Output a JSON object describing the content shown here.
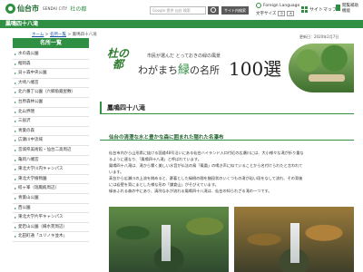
{
  "header": {
    "city_name": "仙台市",
    "city_sub": "SENDAI CITY",
    "city_tag": "杜の都",
    "search_placeholder": "Google 提供 仙台 検索",
    "site_search_label": "サイト内検索",
    "language_label": "Foreign Language",
    "text_size_label": "文字サイズ",
    "text_size_small": "小",
    "text_size_large": "大",
    "sitemap_label": "サイトマップ",
    "accessibility_label": "閲覧補助\n機能"
  },
  "titlebar": {
    "title": "鳳鳴四十八滝"
  },
  "breadcrumb": {
    "home": "ホーム",
    "sep1": " > ",
    "list": "名所一覧",
    "sep2": " > ",
    "current": "鳳鳴四十八滝"
  },
  "sidebar": {
    "title": "名所一覧",
    "items": [
      "水の森公園",
      "榴岡森",
      "貝ヶ森中央公園",
      "大崎八幡宮",
      "北六番丁公園（六郷角蔵屋敷）",
      "台原森林公園",
      "北山界隈",
      "三居沢",
      "青葉の森",
      "広瀬川中流域",
      "宮城県美術館・仙台二高周辺",
      "亀岡八幡宮",
      "東北大学川内キャンパス",
      "東北大学植物園",
      "経ヶ峯（瑞鳳殿周辺）",
      "青葉山公園",
      "西公園",
      "東北大学片平キャンパス",
      "愛宕山公園（縁水苑周辺）",
      "北田町通「ユリノキ並木」"
    ]
  },
  "main": {
    "updated": "更新日：2020年2月7日",
    "banner": {
      "mark": "杜の都",
      "subtitle": "市民が選んだ とっておきの緑の風景",
      "title_part1": "わがまち",
      "title_green": "緑",
      "title_part2": "の名所",
      "number": "100選"
    },
    "heading": "鳳鳴四十八滝",
    "subhead": "仙台の清澄な水と豊かな森に囲まれた隠れた名瀑布",
    "paragraphs": [
      "仙台市内から山形県に抜ける国道48号沿いにある仙台ハイランド入口付近の広瀬川には、大小様々な滝が折り重な",
      "るように連なり、「鳳鳴四十八滝」と呼ばれています。",
      "鳳鳴四十八滝は、滝から響く美しい水音が仏法の鳥「鳳凰」の鳴き声に似ていることから名付けられたと言われて",
      "います。",
      "高台から広瀬川の上流を眺めると、豪著とした緑樹の間を猶段状のいくつもの滝が岩い段をなして流れ、その背後",
      "には岩壁を背にまとした様な形の「鎌倉山」がそびえています。",
      "緑あふれる森の中にあり、清冽な水が流れる鳳鳴四十八滝は、仙台の知られざる滝の一つです。"
    ]
  }
}
